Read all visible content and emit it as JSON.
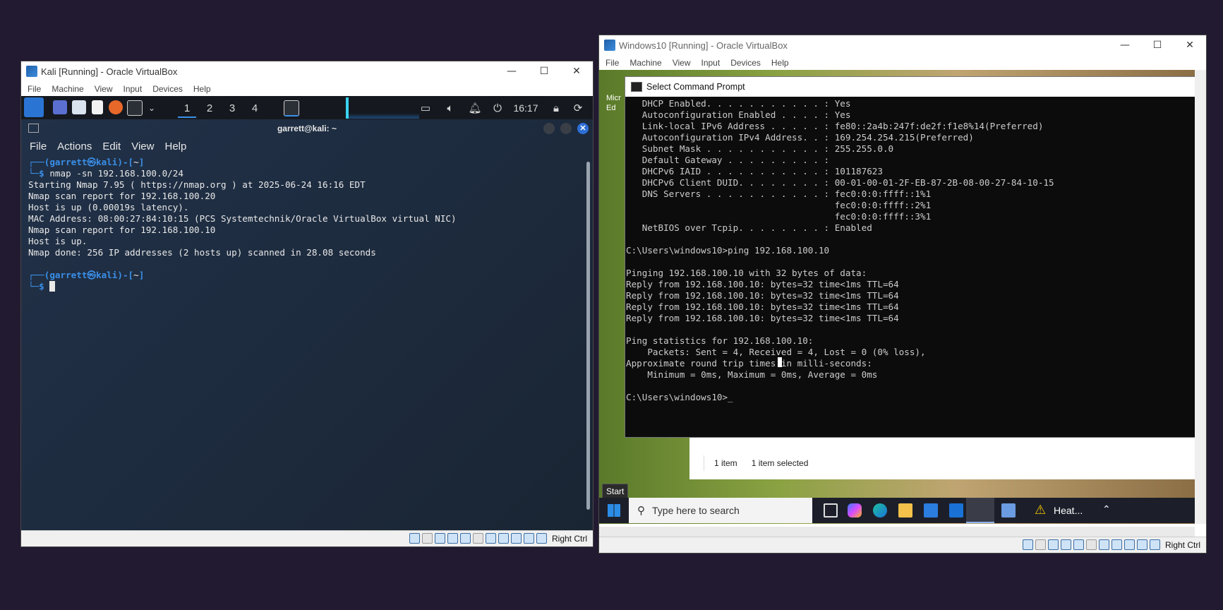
{
  "kali": {
    "window_title": "Kali [Running] - Oracle VirtualBox",
    "menu": [
      "File",
      "Machine",
      "View",
      "Input",
      "Devices",
      "Help"
    ],
    "workspaces": [
      "1",
      "2",
      "3",
      "4"
    ],
    "clock": "16:17",
    "terminal_title": "garrett@kali: ~",
    "terminal_menu": [
      "File",
      "Actions",
      "Edit",
      "View",
      "Help"
    ],
    "prompt_user": "garrett",
    "prompt_at": "㉿",
    "prompt_host": "kali",
    "prompt_dir": "~",
    "command": "nmap -sn 192.168.100.0/24",
    "output": [
      "Starting Nmap 7.95 ( https://nmap.org ) at 2025-06-24 16:16 EDT",
      "Nmap scan report for 192.168.100.20",
      "Host is up (0.00019s latency).",
      "MAC Address: 08:00:27:84:10:15 (PCS Systemtechnik/Oracle VirtualBox virtual NIC)",
      "Nmap scan report for 192.168.100.10",
      "Host is up.",
      "Nmap done: 256 IP addresses (2 hosts up) scanned in 28.08 seconds"
    ],
    "host_key": "Right Ctrl"
  },
  "win": {
    "window_title": "Windows10 [Running] - Oracle VirtualBox",
    "menu": [
      "File",
      "Machine",
      "View",
      "Input",
      "Devices",
      "Help"
    ],
    "cmd_title": "Select Command Prompt",
    "cmd_lines": [
      "   DHCP Enabled. . . . . . . . . . . : Yes",
      "   Autoconfiguration Enabled . . . . : Yes",
      "   Link-local IPv6 Address . . . . . : fe80::2a4b:247f:de2f:f1e8%14(Preferred)",
      "   Autoconfiguration IPv4 Address. . : 169.254.254.215(Preferred)",
      "   Subnet Mask . . . . . . . . . . . : 255.255.0.0",
      "   Default Gateway . . . . . . . . . :",
      "   DHCPv6 IAID . . . . . . . . . . . : 101187623",
      "   DHCPv6 Client DUID. . . . . . . . : 00-01-00-01-2F-EB-87-2B-08-00-27-84-10-15",
      "   DNS Servers . . . . . . . . . . . : fec0:0:0:ffff::1%1",
      "                                       fec0:0:0:ffff::2%1",
      "                                       fec0:0:0:ffff::3%1",
      "   NetBIOS over Tcpip. . . . . . . . : Enabled",
      "",
      "C:\\Users\\windows10>ping 192.168.100.10",
      "",
      "Pinging 192.168.100.10 with 32 bytes of data:",
      "Reply from 192.168.100.10: bytes=32 time<1ms TTL=64",
      "Reply from 192.168.100.10: bytes=32 time<1ms TTL=64",
      "Reply from 192.168.100.10: bytes=32 time<1ms TTL=64",
      "Reply from 192.168.100.10: bytes=32 time<1ms TTL=64",
      "",
      "Ping statistics for 192.168.100.10:",
      "    Packets: Sent = 4, Received = 4, Lost = 0 (0% loss),",
      "Approximate round trip times in milli-seconds:",
      "    Minimum = 0ms, Maximum = 0ms, Average = 0ms",
      "",
      "C:\\Users\\windows10>_"
    ],
    "explorer_status": [
      "1 item",
      "1 item selected"
    ],
    "desktop_label": "Micr\nEd",
    "start_tooltip": "Start",
    "search_placeholder": "Type here to search",
    "weather": "Heat...",
    "host_key": "Right Ctrl"
  },
  "icons": {
    "kali_app": "terminal-icon",
    "win_search": "search-icon",
    "weather": "warning-icon"
  },
  "colors": {
    "desktop_bg": "#221a30",
    "kali_prompt": "#3a8fe8",
    "cmd_bg": "#0c0c0c"
  }
}
